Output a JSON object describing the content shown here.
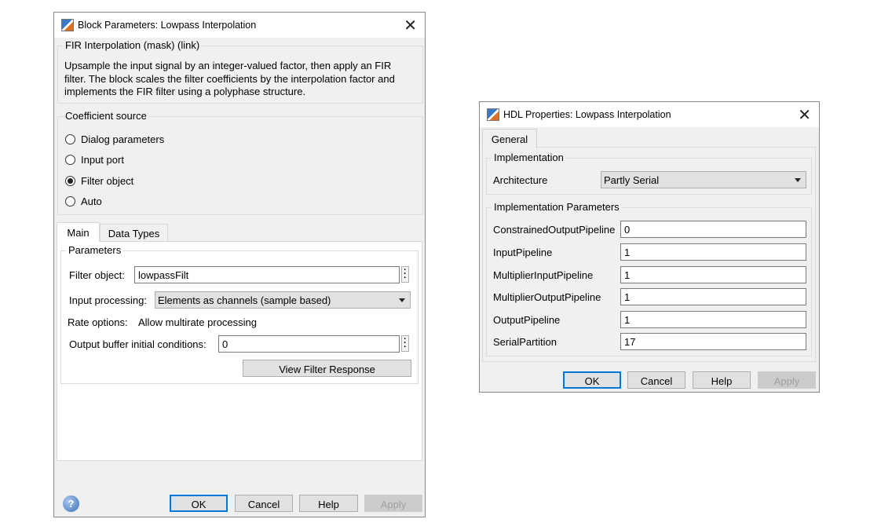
{
  "block_dialog": {
    "title": "Block Parameters: Lowpass Interpolation",
    "mask_group": "FIR Interpolation (mask) (link)",
    "description": [
      "Upsample the input signal by an integer-valued factor, then apply an FIR",
      "filter. The block scales the filter coefficients by the interpolation factor and",
      "implements the FIR filter using a polyphase structure."
    ],
    "coef_group": "Coefficient source",
    "radios": [
      {
        "label": "Dialog parameters",
        "checked": false
      },
      {
        "label": "Input port",
        "checked": false
      },
      {
        "label": "Filter object",
        "checked": true
      },
      {
        "label": "Auto",
        "checked": false
      }
    ],
    "tabs": [
      "Main",
      "Data Types"
    ],
    "params_group": "Parameters",
    "filter_object_label": "Filter object:",
    "filter_object_value": "lowpassFilt",
    "input_processing_label": "Input processing:",
    "input_processing_value": "Elements as channels (sample based)",
    "rate_options_label": "Rate options:",
    "rate_options_value": "Allow multirate processing",
    "output_buffer_label": "Output buffer initial conditions:",
    "output_buffer_value": "0",
    "view_filter_response": "View Filter Response",
    "buttons": {
      "ok": "OK",
      "cancel": "Cancel",
      "help": "Help",
      "apply": "Apply"
    },
    "help_icon": "?"
  },
  "hdl_dialog": {
    "title": "HDL Properties: Lowpass Interpolation",
    "tab": "General",
    "impl_group": "Implementation",
    "architecture_label": "Architecture",
    "architecture_value": "Partly Serial",
    "params_group": "Implementation Parameters",
    "params": [
      {
        "label": "ConstrainedOutputPipeline",
        "value": "0"
      },
      {
        "label": "InputPipeline",
        "value": "1"
      },
      {
        "label": "MultiplierInputPipeline",
        "value": "1"
      },
      {
        "label": "MultiplierOutputPipeline",
        "value": "1"
      },
      {
        "label": "OutputPipeline",
        "value": "1"
      },
      {
        "label": "SerialPartition",
        "value": "17"
      }
    ],
    "buttons": {
      "ok": "OK",
      "cancel": "Cancel",
      "help": "Help",
      "apply": "Apply"
    }
  }
}
